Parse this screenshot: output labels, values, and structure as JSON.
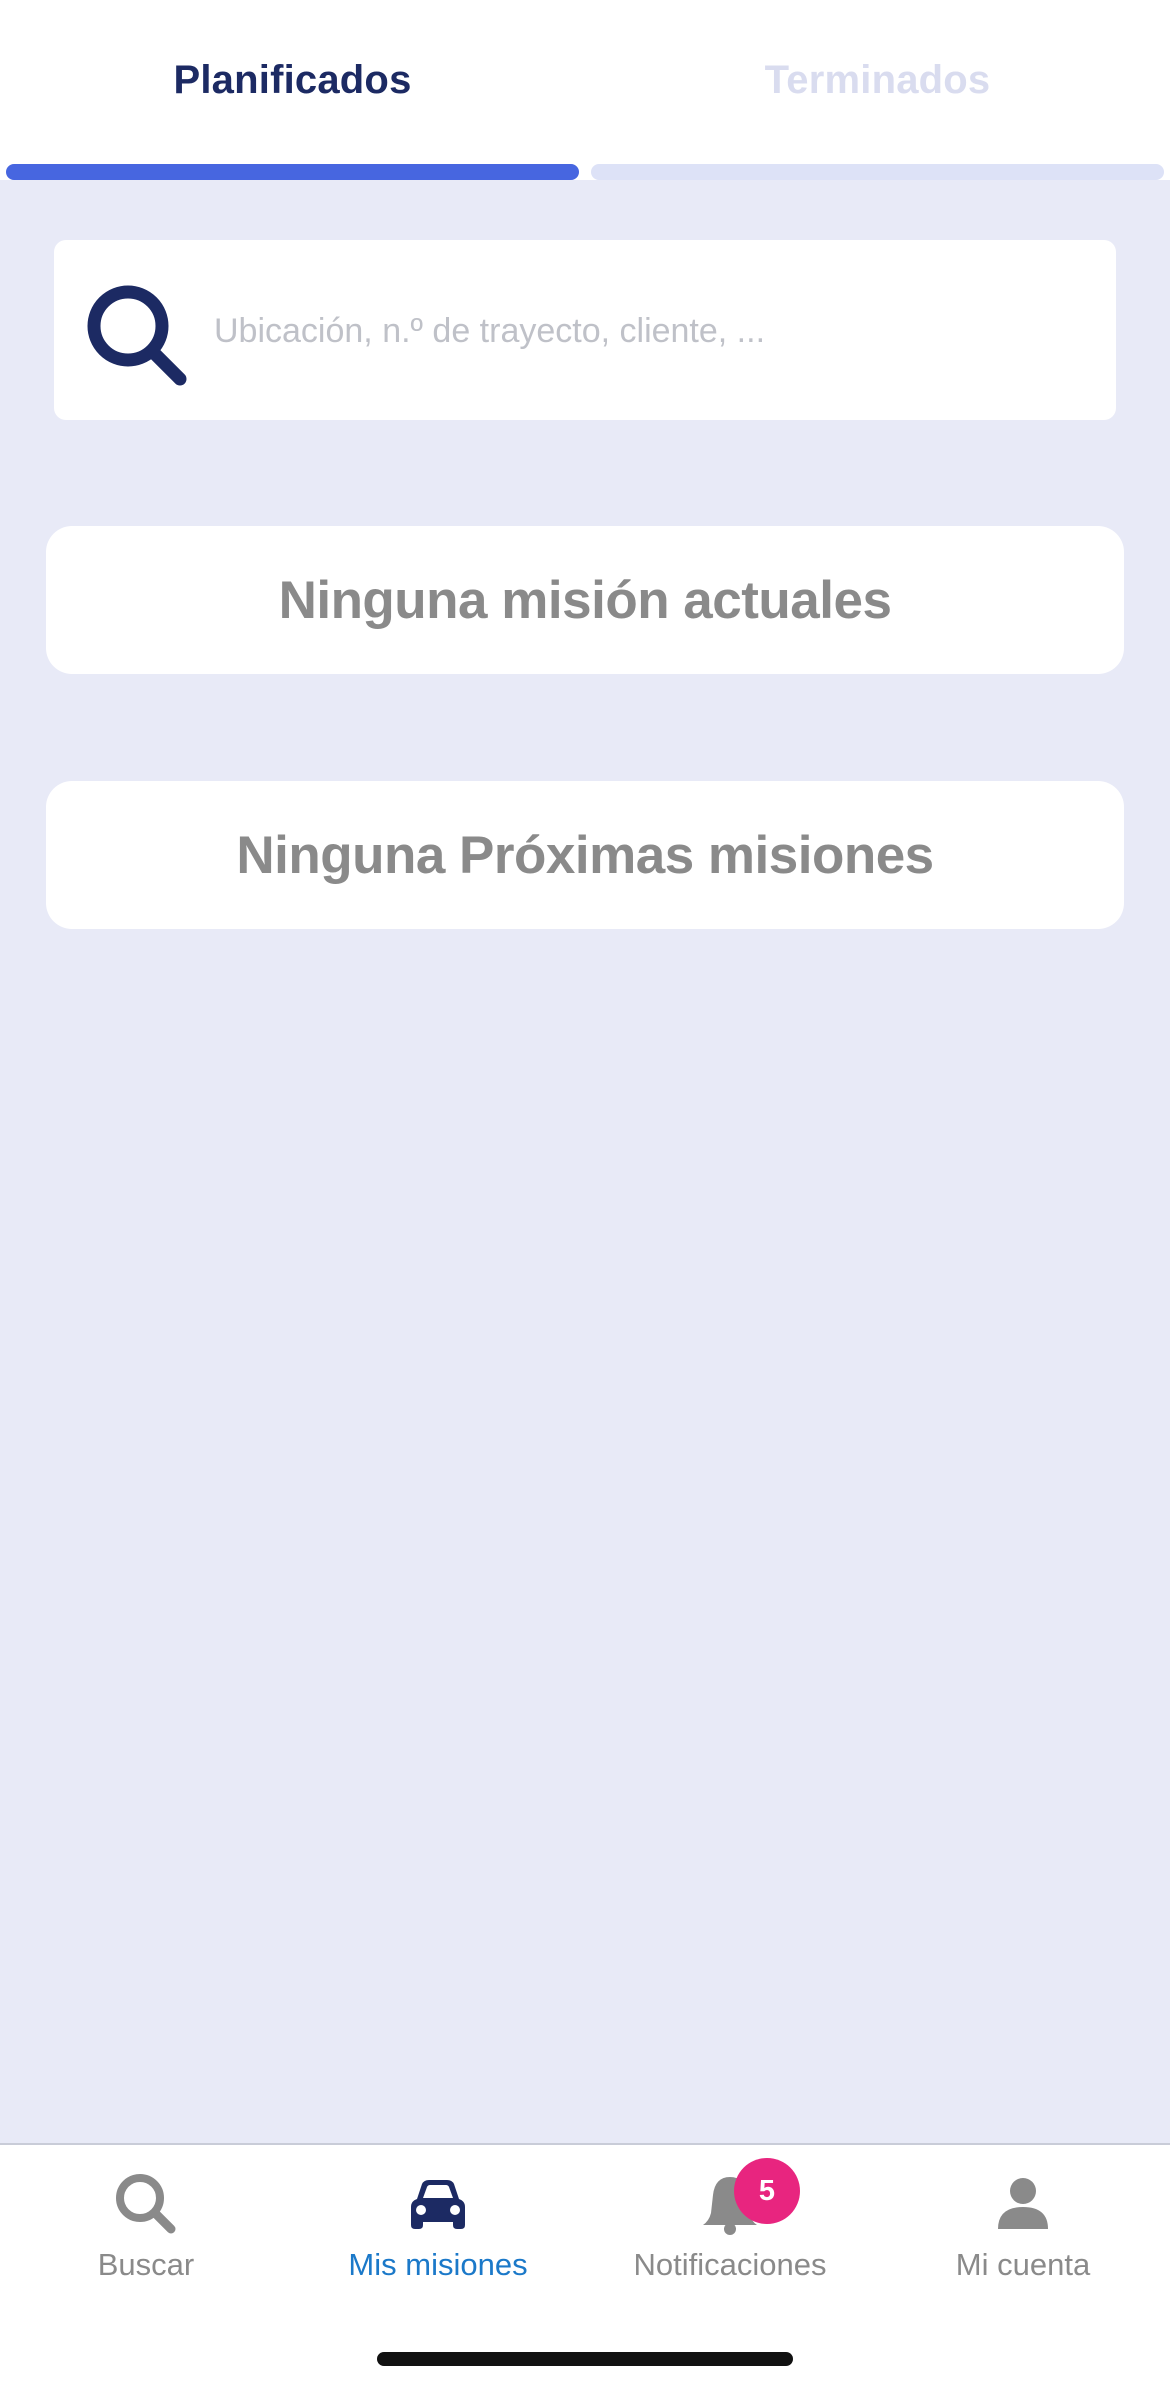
{
  "tabs": [
    {
      "label": "Planificados",
      "active": true
    },
    {
      "label": "Terminados",
      "active": false
    }
  ],
  "search": {
    "placeholder": "Ubicación, n.º de trayecto, cliente, ..."
  },
  "empty_states": {
    "current": "Ninguna misión actuales",
    "upcoming": "Ninguna Próximas misiones"
  },
  "bottom_nav": {
    "items": [
      {
        "label": "Buscar",
        "icon": "search-icon",
        "active": false
      },
      {
        "label": "Mis misiones",
        "icon": "car-icon",
        "active": true
      },
      {
        "label": "Notificaciones",
        "icon": "bell-icon",
        "active": false,
        "badge": "5"
      },
      {
        "label": "Mi cuenta",
        "icon": "person-icon",
        "active": false
      }
    ]
  },
  "colors": {
    "active_tab_text": "#1c2a63",
    "active_tab_indicator": "#4766e0",
    "background": "#e8eaf7",
    "active_nav": "#1b79c9",
    "badge": "#e8257f"
  }
}
